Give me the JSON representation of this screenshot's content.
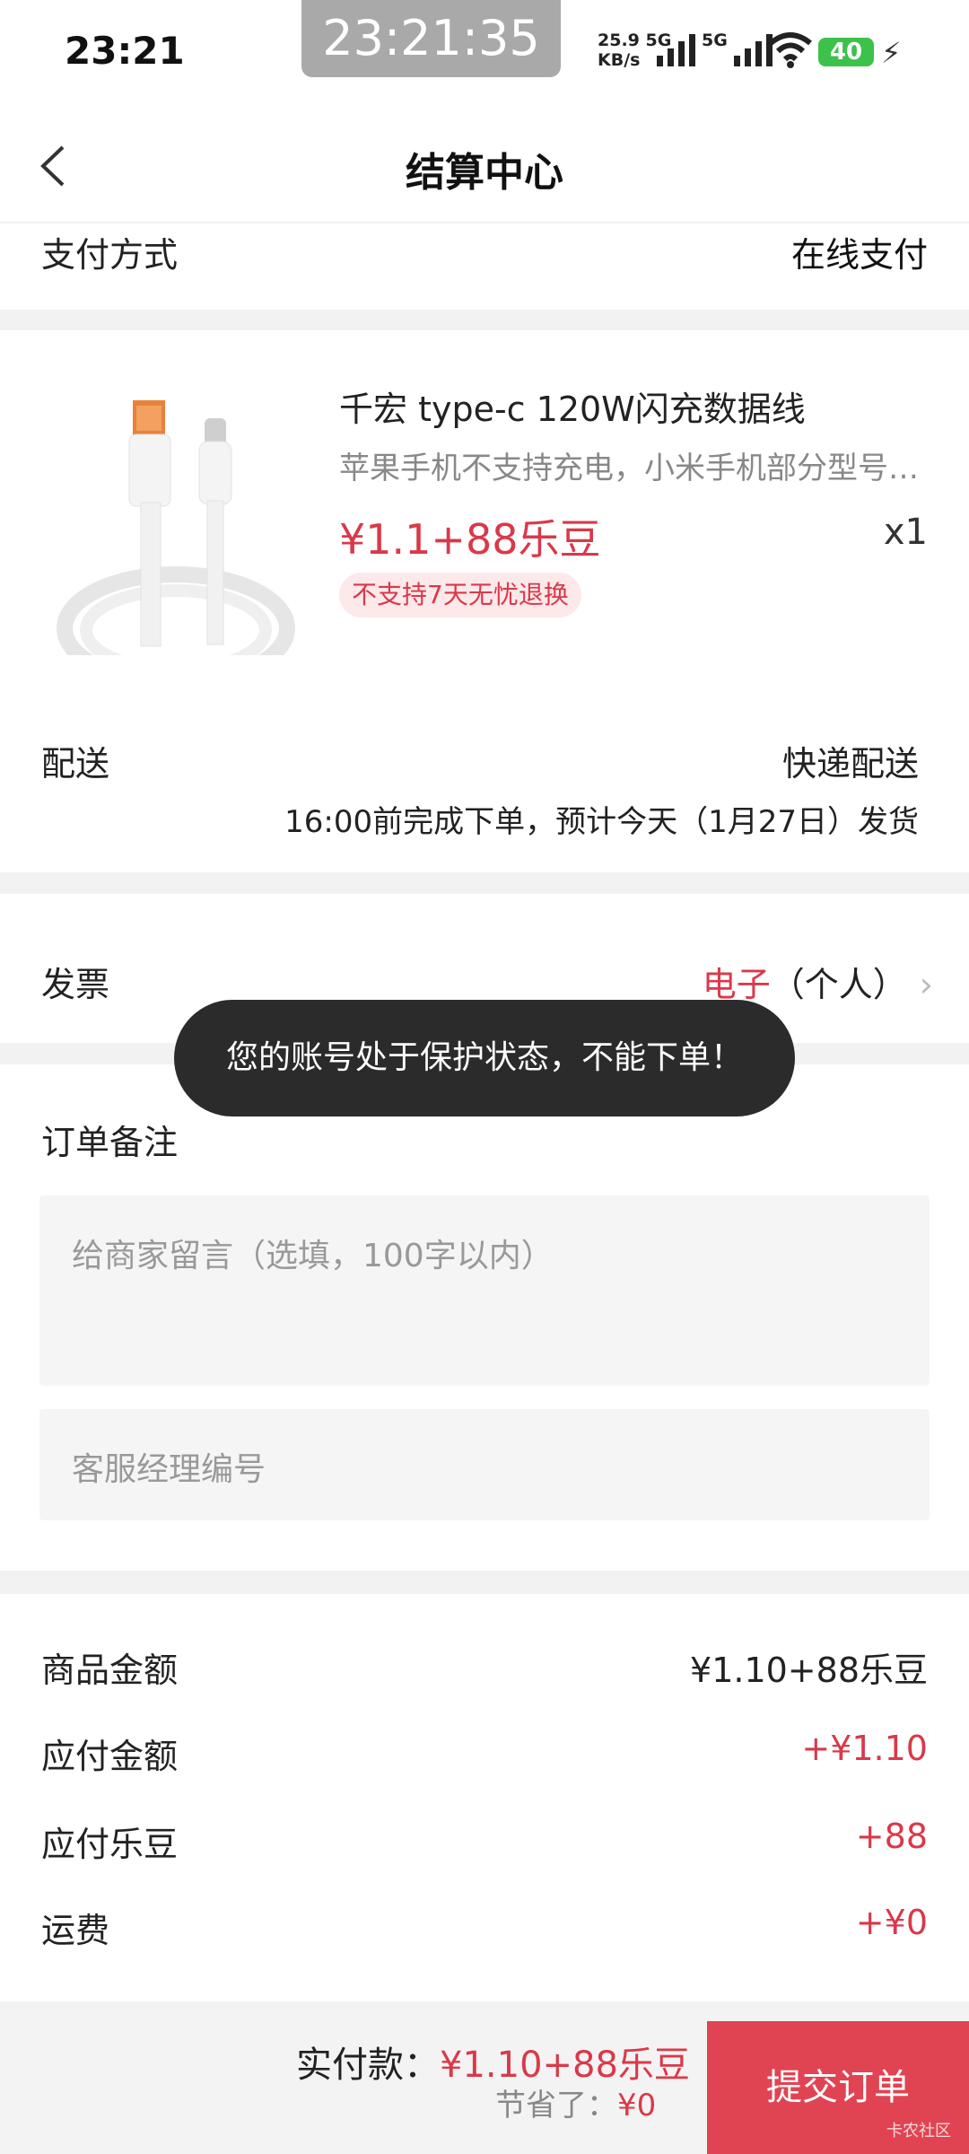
{
  "status": {
    "time": "23:21",
    "clock": "23:21:35",
    "net_speed_top": "25.9",
    "net_speed_unit": "KB/s",
    "sim1_tag": "5G",
    "sim2_tag": "5G",
    "battery": "40"
  },
  "nav": {
    "title": "结算中心"
  },
  "payment": {
    "label": "支付方式",
    "value": "在线支付"
  },
  "product": {
    "name": "千宏 type-c 120W闪充数据线",
    "desc": "苹果手机不支持充电，小米手机部分型号…",
    "price": "¥1.1+88乐豆",
    "qty": "x1",
    "badge": "不支持7天无忧退换"
  },
  "delivery": {
    "label": "配送",
    "value": "快递配送",
    "note": "16:00前完成下单，预计今天（1月27日）发货"
  },
  "invoice": {
    "label": "发票",
    "value_red": "电子",
    "value_rest": "（个人）"
  },
  "toast": {
    "text": "您的账号处于保护状态，不能下单！"
  },
  "remark": {
    "label": "订单备注",
    "placeholder": "给商家留言（选填，100字以内）",
    "manager_placeholder": "客服经理编号"
  },
  "summary": {
    "goods_label": "商品金额",
    "goods_value": "¥1.10+88乐豆",
    "payable_label": "应付金额",
    "payable_value": "+¥1.10",
    "beans_label": "应付乐豆",
    "beans_value": "+88",
    "freight_label": "运费",
    "freight_value": "+¥0"
  },
  "bottom": {
    "pay_label": "实付款：",
    "pay_amount": "¥1.10+88乐豆",
    "saved_label": "节省了：",
    "saved_value": "¥0",
    "submit": "提交订单",
    "watermark": "卡农社区"
  },
  "colors": {
    "accent": "#d9394a",
    "button": "#e04452"
  },
  "icons": [
    "back-icon",
    "chevron-right-icon",
    "wifi-icon",
    "signal-icon",
    "bolt-icon"
  ]
}
